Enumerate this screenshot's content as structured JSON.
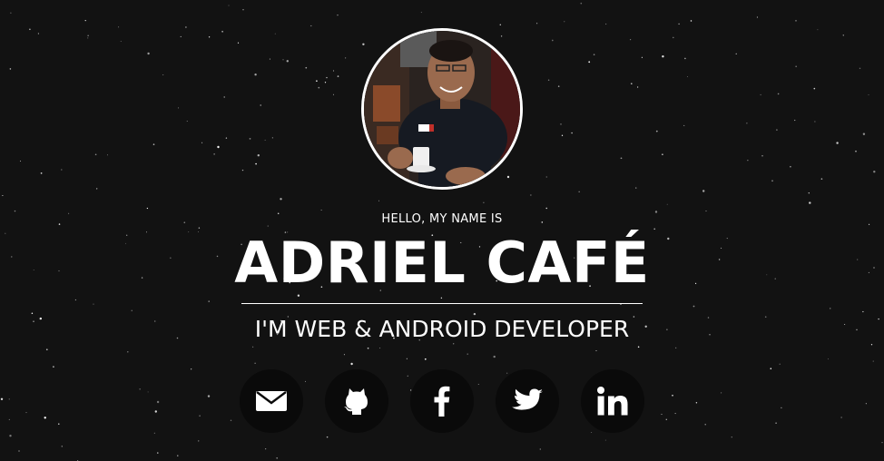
{
  "hero": {
    "greeting": "HELLO, MY NAME IS",
    "name": "ADRIEL CAFÉ",
    "role": "I'M WEB & ANDROID DEVELOPER"
  },
  "social_links": [
    {
      "icon": "email-icon",
      "label": "Email"
    },
    {
      "icon": "github-icon",
      "label": "GitHub"
    },
    {
      "icon": "facebook-icon",
      "label": "Facebook"
    },
    {
      "icon": "twitter-icon",
      "label": "Twitter"
    },
    {
      "icon": "linkedin-icon",
      "label": "LinkedIn"
    }
  ],
  "colors": {
    "background": "#121212",
    "text": "#ffffff",
    "button_background": "#0a0a0a"
  }
}
